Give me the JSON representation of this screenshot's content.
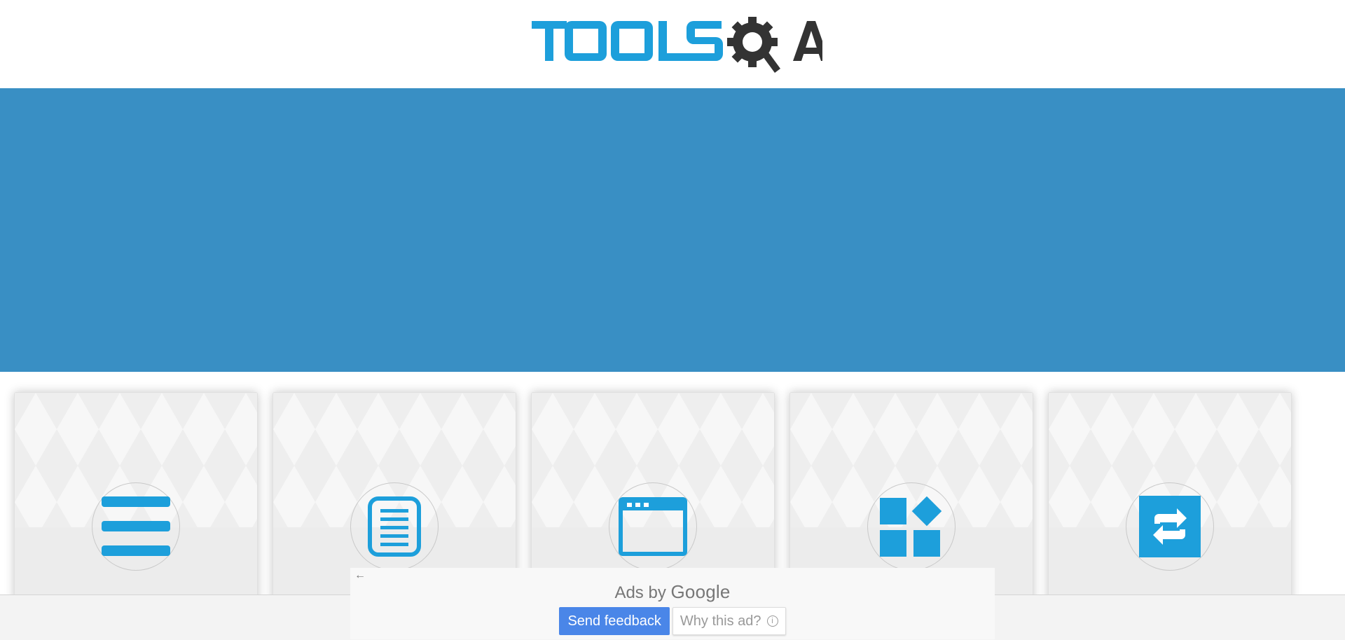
{
  "header": {
    "logo_text": "TOOLSQA",
    "logo_colors": {
      "tools": "#1d9fdb",
      "qa": "#333333"
    }
  },
  "banner": {
    "color": "#398fc4"
  },
  "cards": [
    {
      "icon": "hamburger-list-icon",
      "title": ""
    },
    {
      "icon": "document-form-icon",
      "title": ""
    },
    {
      "icon": "browser-window-icon",
      "title": ""
    },
    {
      "icon": "widgets-shapes-icon",
      "title": ""
    },
    {
      "icon": "interactions-arrows-icon",
      "title": ""
    }
  ],
  "ad": {
    "back_arrow": "←",
    "ads_by": "Ads by",
    "google": "Google",
    "send_feedback": "Send feedback",
    "why_this_ad": "Why this ad?",
    "info_glyph": "i"
  },
  "colors": {
    "icon_blue": "#1d9fdb",
    "button_blue": "#4a86e8"
  }
}
